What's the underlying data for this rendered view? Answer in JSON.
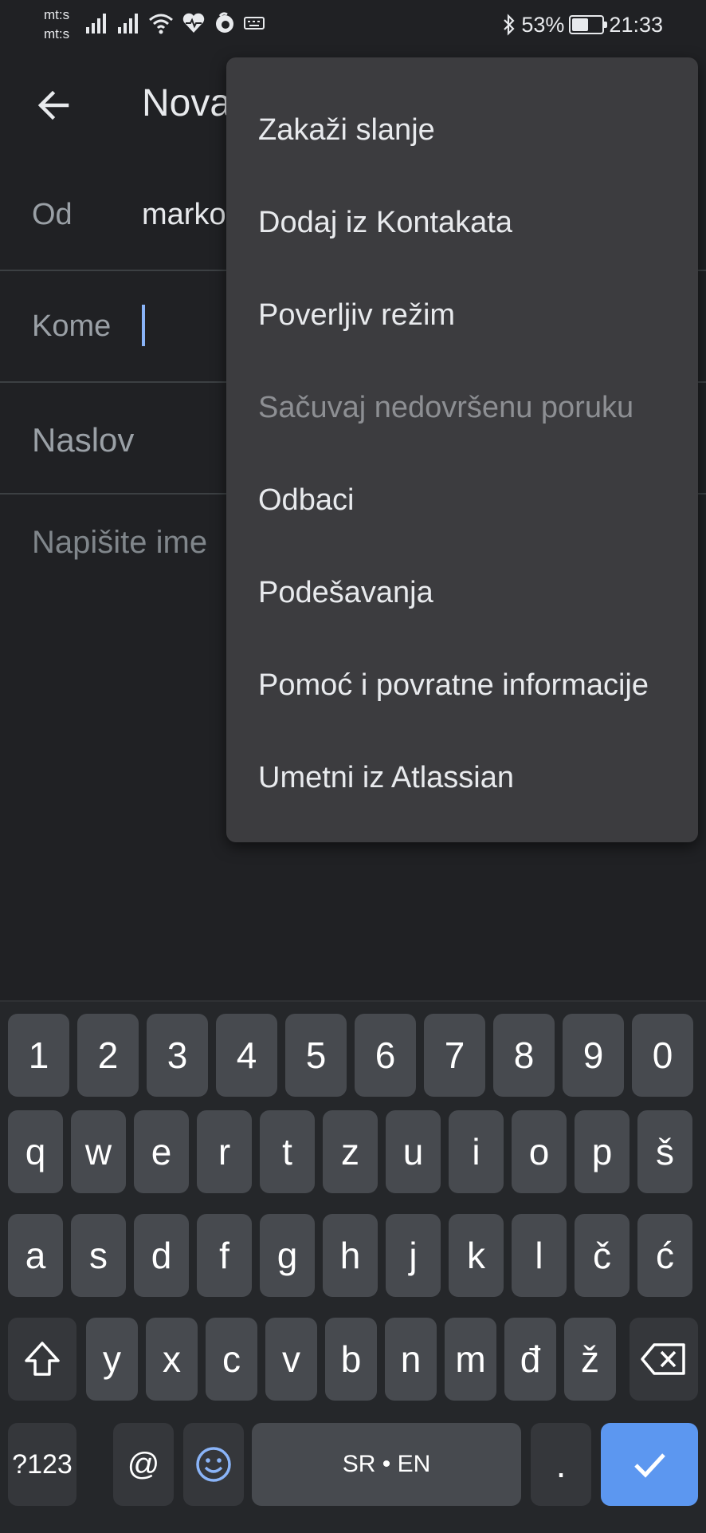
{
  "status_bar": {
    "carrier_1": "mt:s",
    "carrier_2": "mt:s",
    "battery_percent": "53%",
    "battery_level": 0.53,
    "time": "21:33"
  },
  "app_bar": {
    "title": "Nova"
  },
  "compose": {
    "from_label": "Od",
    "from_value": "marko",
    "to_label": "Kome",
    "subject_placeholder": "Naslov",
    "body_placeholder": "Napišite ime"
  },
  "menu": {
    "items": [
      {
        "label": "Zakaži slanje",
        "enabled": true
      },
      {
        "label": "Dodaj iz Kontakata",
        "enabled": true
      },
      {
        "label": "Poverljiv režim",
        "enabled": true
      },
      {
        "label": "Sačuvaj nedovršenu poruku",
        "enabled": false
      },
      {
        "label": "Odbaci",
        "enabled": true
      },
      {
        "label": "Podešavanja",
        "enabled": true
      },
      {
        "label": "Pomoć i povratne informacije",
        "enabled": true
      },
      {
        "label": "Umetni iz Atlassian",
        "enabled": true
      }
    ]
  },
  "keyboard": {
    "numbers": [
      "1",
      "2",
      "3",
      "4",
      "5",
      "6",
      "7",
      "8",
      "9",
      "0"
    ],
    "row1": [
      "q",
      "w",
      "e",
      "r",
      "t",
      "z",
      "u",
      "i",
      "o",
      "p",
      "š"
    ],
    "row2": [
      "a",
      "s",
      "d",
      "f",
      "g",
      "h",
      "j",
      "k",
      "l",
      "č",
      "ć"
    ],
    "row3": [
      "y",
      "x",
      "c",
      "v",
      "b",
      "n",
      "m",
      "đ",
      "ž"
    ],
    "symbols_key": "?123",
    "at_key": "@",
    "space_label": "SR • EN",
    "period_key": "."
  },
  "colors": {
    "background": "#202124",
    "menu_background": "#3c3c3f",
    "accent": "#8ab4f8",
    "enter_key": "#5c97f0"
  }
}
